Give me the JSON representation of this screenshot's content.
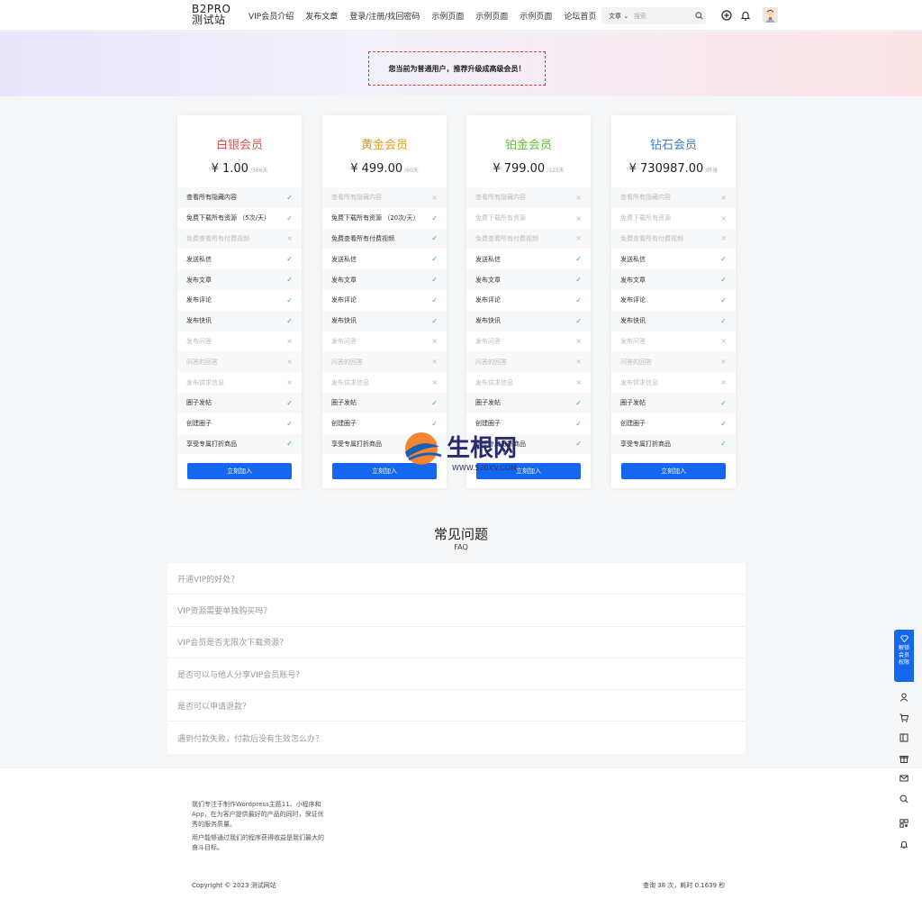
{
  "header": {
    "logo_line1": "B2PRO",
    "logo_line2": "测试站",
    "nav": [
      "VIP会员介绍",
      "发布文章",
      "登录/注册/找回密码",
      "示例页面",
      "示例页面",
      "示例页面",
      "论坛首页"
    ],
    "search_type": "文章",
    "search_placeholder": "搜索"
  },
  "banner": {
    "notice": "您当前为普通用户，推荐升级成高级会员！"
  },
  "plans": [
    {
      "name": "白银会员",
      "color": "#e0554a",
      "price": "¥ 1.00",
      "unit": "/366天",
      "rows": [
        {
          "label": "查看所有隐藏内容",
          "on": true
        },
        {
          "label": "免费下载所有资源 （5次/天）",
          "on": true
        },
        {
          "label": "免费查看所有付费视频",
          "on": false
        },
        {
          "label": "发送私信",
          "on": true
        },
        {
          "label": "发布文章",
          "on": true
        },
        {
          "label": "发布评论",
          "on": true
        },
        {
          "label": "发布快讯",
          "on": true
        },
        {
          "label": "发布问答",
          "on": false
        },
        {
          "label": "问答的回答",
          "on": false
        },
        {
          "label": "发布供求信息",
          "on": false
        },
        {
          "label": "圈子发帖",
          "on": true
        },
        {
          "label": "创建圈子",
          "on": true
        },
        {
          "label": "享受专属打折商品",
          "on": true
        }
      ],
      "button": "立刻加入"
    },
    {
      "name": "黄金会员",
      "color": "#e69a1f",
      "price": "¥ 499.00",
      "unit": "/60天",
      "rows": [
        {
          "label": "查看所有隐藏内容",
          "on": false
        },
        {
          "label": "免费下载所有资源 （20次/天）",
          "on": true
        },
        {
          "label": "免费查看所有付费视频",
          "on": true
        },
        {
          "label": "发送私信",
          "on": true
        },
        {
          "label": "发布文章",
          "on": true
        },
        {
          "label": "发布评论",
          "on": true
        },
        {
          "label": "发布快讯",
          "on": true
        },
        {
          "label": "发布问答",
          "on": false
        },
        {
          "label": "问答的回答",
          "on": false
        },
        {
          "label": "发布供求信息",
          "on": false
        },
        {
          "label": "圈子发帖",
          "on": true
        },
        {
          "label": "创建圈子",
          "on": true
        },
        {
          "label": "享受专属打折商品",
          "on": true
        }
      ],
      "button": "立刻加入"
    },
    {
      "name": "铂金会员",
      "color": "#6bbf3a",
      "price": "¥ 799.00",
      "unit": "/120天",
      "rows": [
        {
          "label": "查看所有隐藏内容",
          "on": false
        },
        {
          "label": "免费下载所有资源",
          "on": false
        },
        {
          "label": "免费查看所有付费视频",
          "on": false
        },
        {
          "label": "发送私信",
          "on": true
        },
        {
          "label": "发布文章",
          "on": true
        },
        {
          "label": "发布评论",
          "on": true
        },
        {
          "label": "发布快讯",
          "on": true
        },
        {
          "label": "发布问答",
          "on": false
        },
        {
          "label": "问答的回答",
          "on": false
        },
        {
          "label": "发布供求信息",
          "on": false
        },
        {
          "label": "圈子发帖",
          "on": true
        },
        {
          "label": "创建圈子",
          "on": true
        },
        {
          "label": "享受专属打折商品",
          "on": true
        }
      ],
      "button": "立刻加入"
    },
    {
      "name": "钻石会员",
      "color": "#3f7cc9",
      "price": "¥ 730987.00",
      "unit": "/终身",
      "rows": [
        {
          "label": "查看所有隐藏内容",
          "on": false
        },
        {
          "label": "免费下载所有资源",
          "on": false
        },
        {
          "label": "免费查看所有付费视频",
          "on": false
        },
        {
          "label": "发送私信",
          "on": true
        },
        {
          "label": "发布文章",
          "on": true
        },
        {
          "label": "发布评论",
          "on": true
        },
        {
          "label": "发布快讯",
          "on": true
        },
        {
          "label": "发布问答",
          "on": false
        },
        {
          "label": "问答的回答",
          "on": false
        },
        {
          "label": "发布供求信息",
          "on": false
        },
        {
          "label": "圈子发帖",
          "on": true
        },
        {
          "label": "创建圈子",
          "on": true
        },
        {
          "label": "享受专属打折商品",
          "on": true
        }
      ],
      "button": "立刻加入"
    }
  ],
  "watermark": {
    "text": "生根网",
    "url": "WWW.520XV.COM"
  },
  "faq": {
    "title": "常见问题",
    "subtitle": "FAQ",
    "items": [
      "开通VIP的好处？",
      "VIP资源需要单独购买吗？",
      "VIP会员是否无限次下载资源？",
      "是否可以与他人分享VIP会员账号？",
      "是否可以申请退款？",
      "遇到付款失败，付款后没有生效怎么办？"
    ]
  },
  "footer": {
    "desc1": "我们专注于制作Wordpress主题11、小程序和App，在为客户提供最好的产品的同时，保证优秀的服务质量。",
    "desc2": "用户能够通过我们的程序获得收益是我们最大的奋斗目标。",
    "copyright": "Copyright © 2023 测试网站",
    "stats": "查询 38 次，耗时 0.1639 秒"
  },
  "sidebar": {
    "vip_float": [
      "解锁",
      "会员",
      "权限"
    ]
  },
  "colors": {
    "accent": "#1467ee",
    "check": "#2db34a",
    "notice_border": "#ee3333"
  },
  "icons": {
    "header": [
      "search-icon",
      "plus-circle-icon",
      "bell-icon"
    ],
    "side": [
      "user-icon",
      "cart-icon",
      "ticket-icon",
      "gift-icon",
      "mail-icon",
      "search-icon",
      "qrcode-icon",
      "alarm-icon"
    ]
  }
}
